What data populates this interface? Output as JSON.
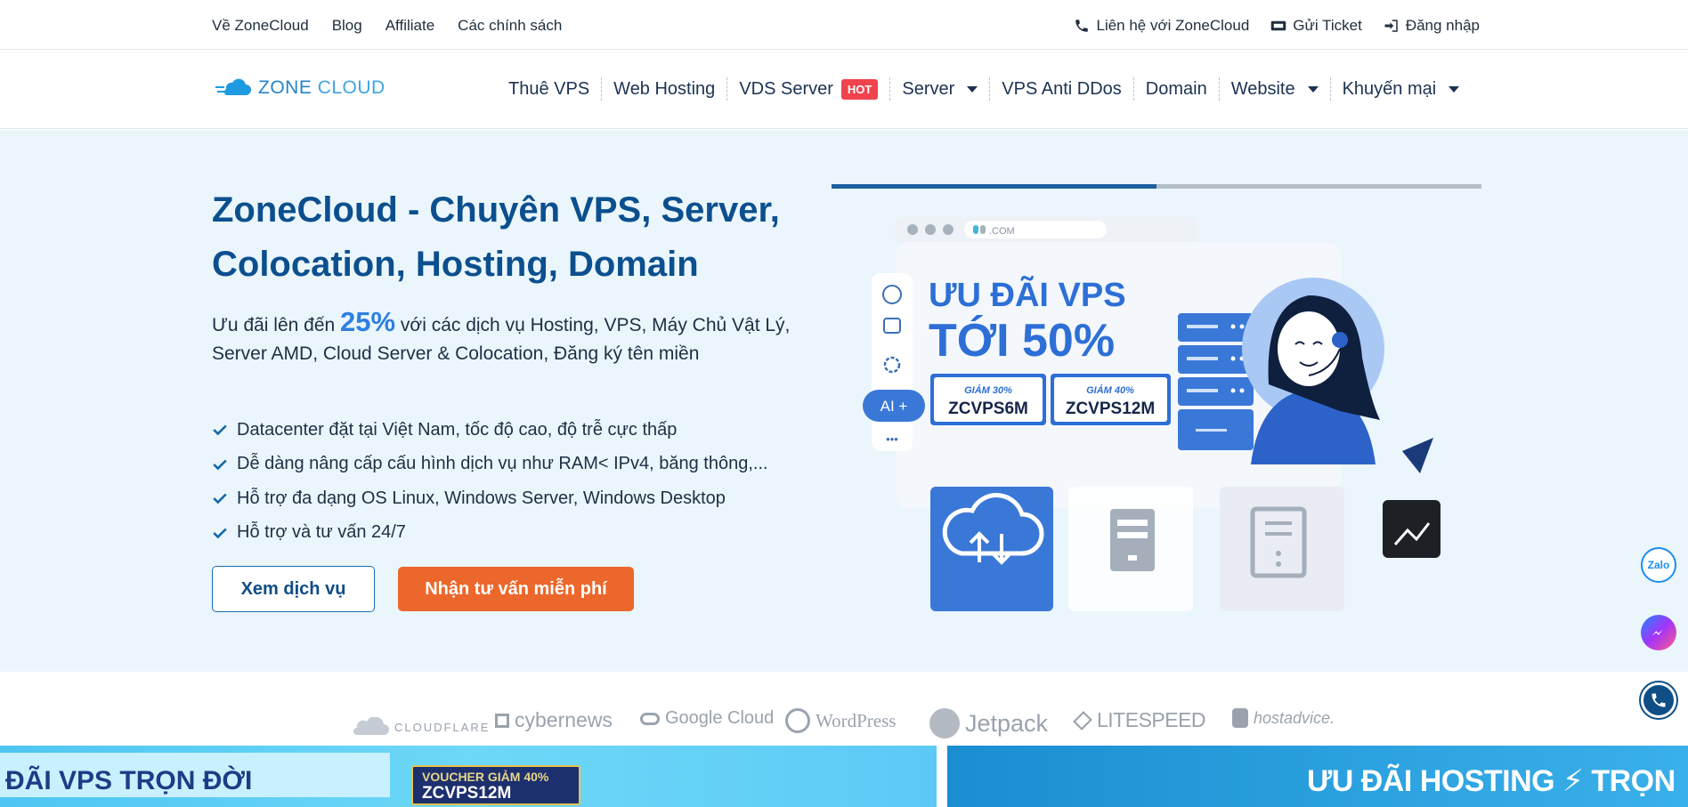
{
  "topbar": {
    "left_links": [
      "Về ZoneCloud",
      "Blog",
      "Affiliate",
      "Các chính sách"
    ],
    "contact": "Liên hệ với ZoneCloud",
    "ticket": "Gửi Ticket",
    "login": "Đăng nhập"
  },
  "logo": {
    "word1": "ZONE",
    "word2": "CLOUD"
  },
  "menu": {
    "items": [
      "Thuê VPS",
      "Web Hosting",
      "VDS Server",
      "Server",
      "VPS Anti DDos",
      "Domain",
      "Website",
      "Khuyến mại"
    ],
    "hot_badge": "HOT"
  },
  "hero": {
    "title": "ZoneCloud - Chuyên VPS, Server, Colocation, Hosting, Domain",
    "sub_prefix": "Ưu đãi lên đến ",
    "sub_pct": "25%",
    "sub_suffix": " với các dịch vụ Hosting, VPS, Máy Chủ Vật Lý, Server AMD, Cloud Server & Colocation, Đăng ký tên miền",
    "features": [
      "Datacenter đặt tại Việt Nam, tốc độ cao, độ trễ cực thấp",
      "Dễ dàng nâng cấp cấu hình dịch vụ như RAM< IPv4, băng thông,...",
      "Hỗ trợ đa dạng OS Linux, Windows Server, Windows Desktop",
      "Hỗ trợ và tư vấn 24/7"
    ],
    "btn_services": "Xem dịch vụ",
    "btn_consult": "Nhận tư vấn miễn phí",
    "slide_progress": 0.5
  },
  "illustration": {
    "url_text": ".COM",
    "headline1": "ƯU ĐÃI VPS",
    "headline2": "TỚI 50%",
    "coupon1_label": "GIẢM 30%",
    "coupon1_code": "ZCVPS6M",
    "coupon2_label": "GIẢM 40%",
    "coupon2_code": "ZCVPS12M",
    "ai_button": "AI +",
    "more_dots": "•••"
  },
  "partners": [
    "CLOUDFLARE",
    "cybernews",
    "Google Cloud",
    "WordPress",
    "Jetpack",
    "LITESPEED",
    "hostadvice."
  ],
  "banners": {
    "b1_text": "ĐÃI VPS TRỌN ĐỜI",
    "b1_voucher_label": "VOUCHER GIẢM 40%",
    "b1_voucher_code": "ZCVPS12M",
    "b2_text": "ƯU ĐÃI HOSTING ⚡ TRỌN"
  },
  "float": {
    "zalo": "Zalo"
  },
  "colors": {
    "primary": "#0c4f8e",
    "accent": "#ec672b",
    "hot": "#f0434e",
    "hero_bg": "#eaf6fc"
  }
}
